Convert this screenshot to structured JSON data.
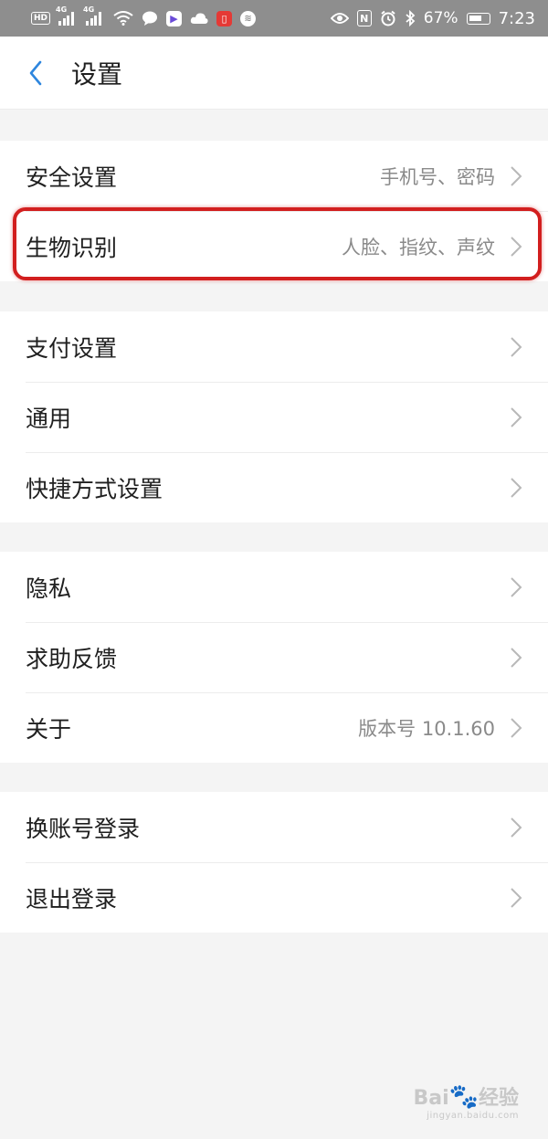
{
  "status_bar": {
    "network_label": "HD",
    "signal1_gen": "4G",
    "signal2_gen": "4G",
    "battery_percent": "67%",
    "time": "7:23",
    "icons": [
      "wifi-icon",
      "chat-icon",
      "video-app-icon",
      "cloud-icon",
      "book-app-icon",
      "audio-app-icon",
      "eye-icon",
      "nfc-icon",
      "alarm-icon",
      "bluetooth-icon",
      "battery-icon"
    ]
  },
  "nav": {
    "title": "设置",
    "back_icon": "chevron-left-icon"
  },
  "groups": [
    {
      "items": [
        {
          "label": "安全设置",
          "value": "手机号、密码"
        },
        {
          "label": "生物识别",
          "value": "人脸、指纹、声纹"
        }
      ]
    },
    {
      "items": [
        {
          "label": "支付设置",
          "value": ""
        },
        {
          "label": "通用",
          "value": ""
        },
        {
          "label": "快捷方式设置",
          "value": ""
        }
      ]
    },
    {
      "items": [
        {
          "label": "隐私",
          "value": ""
        },
        {
          "label": "求助反馈",
          "value": ""
        },
        {
          "label": "关于",
          "value": "版本号 10.1.60"
        }
      ]
    },
    {
      "items": [
        {
          "label": "换账号登录",
          "value": ""
        },
        {
          "label": "退出登录",
          "value": ""
        }
      ]
    }
  ],
  "watermark": {
    "brand": "Bai",
    "brand_suffix": "经验",
    "url": "jingyan.baidu.com"
  },
  "colors": {
    "accent": "#2e86de",
    "highlight": "#d21f1f",
    "chevron": "#b8b8b8"
  }
}
